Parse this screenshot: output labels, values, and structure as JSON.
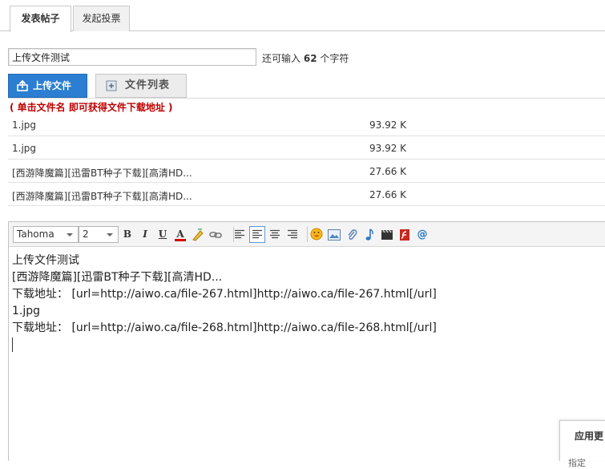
{
  "tabs": [
    {
      "label": "发表帖子",
      "active": true
    },
    {
      "label": "发起投票",
      "active": false
    }
  ],
  "title_field": {
    "value": "上传文件测试"
  },
  "char_counter": {
    "prefix": "还可输入",
    "count": "62",
    "suffix": "个字符"
  },
  "upload": {
    "upload_label": "上传文件",
    "list_label": "文件列表",
    "hint": "( 单击文件名 即可获得文件下载地址 )"
  },
  "files": [
    {
      "name": "1.jpg",
      "size": "93.92 K"
    },
    {
      "name": "1.jpg",
      "size": "93.92 K"
    },
    {
      "name": "[西游降魔篇][迅雷BT种子下载][高清HD...",
      "size": "27.66 K"
    },
    {
      "name": "[西游降魔篇][迅雷BT种子下载][高清HD...",
      "size": "27.66 K"
    }
  ],
  "toolbar": {
    "font": "Tahoma",
    "size": "2",
    "bold": "B",
    "italic": "I",
    "underline": "U",
    "font_color": "A"
  },
  "editor": {
    "lines": [
      "上传文件测试",
      "[西游降魔篇][迅雷BT种子下载][高清HD...",
      "下载地址： [url=http://aiwo.ca/file-267.html]http://aiwo.ca/file-267.html[/url]",
      "1.jpg",
      "下载地址： [url=http://aiwo.ca/file-268.html]http://aiwo.ca/file-268.html[/url]"
    ]
  },
  "side_panel": {
    "title": "应用更",
    "sub": "指定"
  },
  "colors": {
    "accent": "#2b7ed1",
    "hint": "#c00000"
  }
}
